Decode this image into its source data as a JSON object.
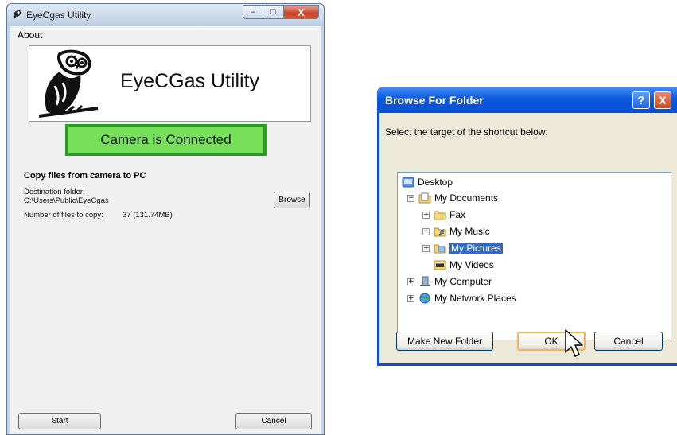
{
  "left_window": {
    "title": "EyeCgas Utility",
    "caption_buttons": {
      "minimize": "–",
      "maximize": "□",
      "close": "X"
    },
    "menu": [
      {
        "label": "About"
      }
    ],
    "banner_text": "EyeCGas Utility",
    "status_text": "Camera is Connected",
    "section_title": "Copy files from camera to PC",
    "destination_label": "Destination folder:",
    "destination_path": "C:\\Users\\Public\\EyeCgas",
    "browse_label": "Browse",
    "files_label": "Number of files to copy:",
    "files_value": "37 (131.74MB)",
    "start_label": "Start",
    "cancel_label": "Cancel"
  },
  "browse_dialog": {
    "title": "Browse For Folder",
    "help_glyph": "?",
    "close_glyph": "X",
    "prompt": "Select the target of the shortcut below:",
    "tree": [
      {
        "label": "Desktop",
        "icon": "desktop-icon",
        "level": 0,
        "expander": ""
      },
      {
        "label": "My Documents",
        "icon": "my-documents-icon",
        "level": 1,
        "expander": "−"
      },
      {
        "label": "Fax",
        "icon": "folder-icon",
        "level": 2,
        "expander": "+"
      },
      {
        "label": "My Music",
        "icon": "music-folder-icon",
        "level": 2,
        "expander": "+"
      },
      {
        "label": "My Pictures",
        "icon": "pictures-folder-icon",
        "level": 2,
        "expander": "+",
        "selected": true
      },
      {
        "label": "My Videos",
        "icon": "videos-folder-icon",
        "level": 2,
        "expander": ""
      },
      {
        "label": "My Computer",
        "icon": "computer-icon",
        "level": 1,
        "expander": "+"
      },
      {
        "label": "My Network Places",
        "icon": "network-icon",
        "level": 1,
        "expander": "+"
      }
    ],
    "make_new_folder_label": "Make New Folder",
    "ok_label": "OK",
    "cancel_label": "Cancel"
  },
  "colors": {
    "status_border": "#2a9c22",
    "status_fill": "#77e05a",
    "xp_titlebar": "#0a4fd4",
    "xp_selection": "#316ac5"
  }
}
